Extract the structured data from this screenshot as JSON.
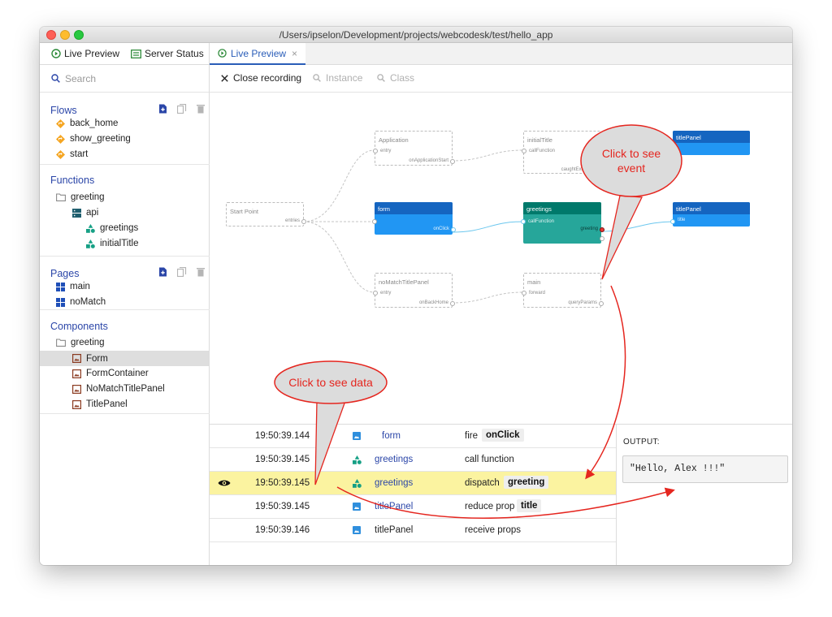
{
  "window": {
    "title": "/Users/ipselon/Development/projects/webcodesk/test/hello_app"
  },
  "sidebar": {
    "tabs": [
      {
        "label": "Live Preview"
      },
      {
        "label": "Server Status"
      }
    ],
    "search_placeholder": "Search",
    "flows": {
      "title": "Flows",
      "items": [
        "back_home",
        "show_greeting",
        "start"
      ]
    },
    "functions": {
      "title": "Functions",
      "folder": "greeting",
      "api": "api",
      "items": [
        "greetings",
        "initialTitle"
      ]
    },
    "pages": {
      "title": "Pages",
      "items": [
        "main",
        "noMatch"
      ]
    },
    "components": {
      "title": "Components",
      "folder": "greeting",
      "items": [
        "Form",
        "FormContainer",
        "NoMatchTitlePanel",
        "TitlePanel"
      ]
    }
  },
  "main": {
    "tab": {
      "label": "Live Preview",
      "close": "×"
    },
    "toolbar": {
      "close": "Close recording",
      "instance": "Instance",
      "class": "Class"
    }
  },
  "diagram": {
    "start": {
      "title": "Start Point",
      "out": "entries"
    },
    "application": {
      "title": "Application",
      "in": "entry",
      "out": "onApplicationStart"
    },
    "initialTitle": {
      "title": "initialTitle",
      "in": "callFunction",
      "out1": "title",
      "out2": "caughtException"
    },
    "titlePanel1": {
      "title": "titlePanel"
    },
    "form": {
      "title": "form",
      "out": "onClick"
    },
    "greetings": {
      "title": "greetings",
      "in": "callFunction",
      "out": "greeting"
    },
    "titlePanel2": {
      "title": "titlePanel",
      "in": "title"
    },
    "noMatch": {
      "title": "noMatchTitlePanel",
      "in": "entry",
      "out": "onBackHome"
    },
    "mainPage": {
      "title": "main",
      "in": "forward",
      "out": "queryParams"
    }
  },
  "log": {
    "rows": [
      {
        "time": "19:50:39.144",
        "name": "form",
        "action": "fire",
        "chip": "onClick",
        "icon": "component-icon"
      },
      {
        "time": "19:50:39.145",
        "name": "greetings",
        "action": "call function",
        "chip": "",
        "icon": "function-icon"
      },
      {
        "time": "19:50:39.145",
        "name": "greetings",
        "action": "dispatch",
        "chip": "greeting",
        "icon": "function-icon"
      },
      {
        "time": "19:50:39.145",
        "name": "titlePanel",
        "action": "reduce prop",
        "chip": "title",
        "icon": "component-icon"
      },
      {
        "time": "19:50:39.146",
        "name": "titlePanel",
        "action": "receive props",
        "chip": "",
        "icon": "component-icon"
      }
    ]
  },
  "output": {
    "label": "OUTPUT:",
    "value": "\"Hello, Alex !!!\""
  },
  "annotations": {
    "event": {
      "line1": "Click to see",
      "line2": "event"
    },
    "data": {
      "text": "Click to see data"
    }
  },
  "colors": {
    "accent": "#2b46a8",
    "blue_node": "#2196f3",
    "teal_node": "#26a69a",
    "highlight": "#fbf3a0",
    "annotation": "#e5261f"
  }
}
